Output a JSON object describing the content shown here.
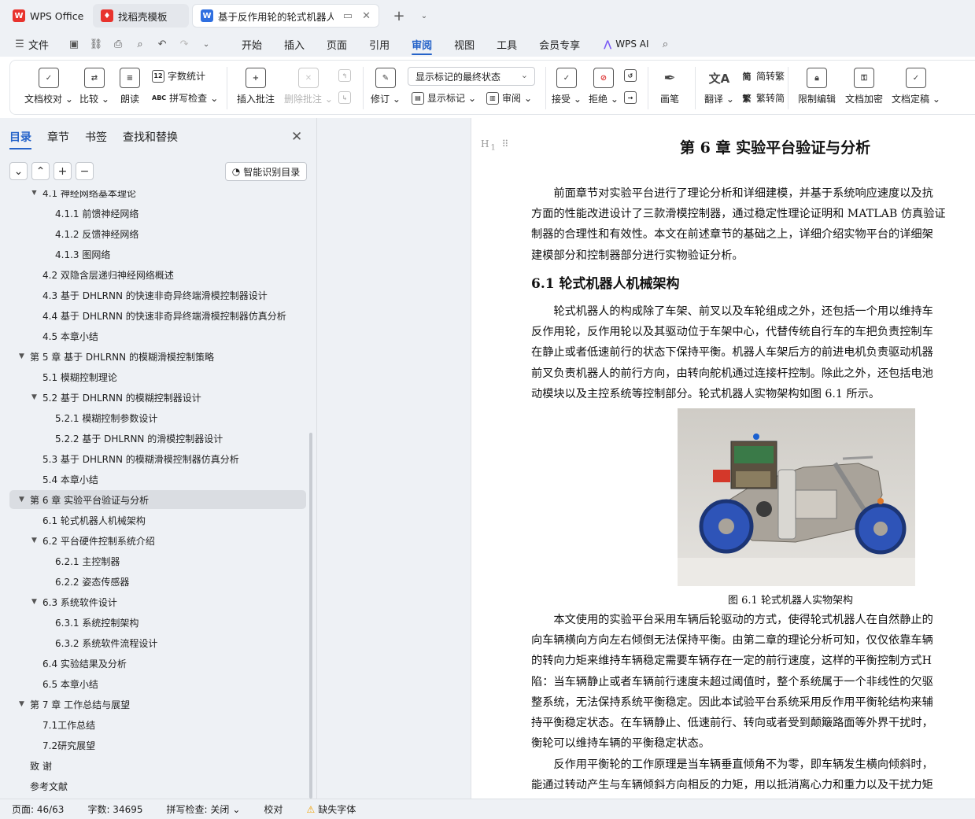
{
  "tabs": [
    {
      "label": "WPS Office",
      "icon": "wps-logo-icon",
      "color": "#e8332d"
    },
    {
      "label": "找稻壳模板",
      "icon": "docer-logo-icon",
      "color": "#e8332d"
    },
    {
      "label": "基于反作用轮的轮式机器人平衡",
      "icon": "writer-doc-icon",
      "color": "#2f6fe0"
    }
  ],
  "new_tab": "+",
  "menu": {
    "file": "文件",
    "items": [
      "开始",
      "插入",
      "页面",
      "引用",
      "审阅",
      "视图",
      "工具",
      "会员专享"
    ],
    "active": "审阅",
    "wps_ai": "WPS AI"
  },
  "ribbon": {
    "doc_check": "文档校对",
    "compare": "比较",
    "read_aloud": "朗读",
    "word_count": "字数统计",
    "spell_check": "拼写检查",
    "insert_comment": "插入批注",
    "delete_comment": "删除批注",
    "revise": "修订",
    "markup_select": "显示标记的最终状态",
    "show_markup": "显示标记",
    "review": "审阅",
    "accept": "接受",
    "reject": "拒绝",
    "pen": "画笔",
    "translate": "翻译",
    "to_traditional": "简转繁",
    "to_simplified": "繁转简",
    "restrict_edit": "限制编辑",
    "encrypt": "文档加密",
    "finalize": "文档定稿",
    "word_count_icon_text": "12",
    "spell_icon_text": "ABC"
  },
  "sidebar": {
    "tabs": [
      "目录",
      "章节",
      "书签",
      "查找和替换"
    ],
    "active_tab": "目录",
    "smart_toc": "智能识别目录",
    "toc": [
      {
        "label": "4.1 神经网络基本理论",
        "level": 2,
        "expanded": true
      },
      {
        "label": "4.1.1  前馈神经网络",
        "level": 3
      },
      {
        "label": "4.1.2  反馈神经网络",
        "level": 3
      },
      {
        "label": "4.1.3  图网络",
        "level": 3
      },
      {
        "label": "4.2  双隐含层递归神经网络概述",
        "level": 2
      },
      {
        "label": "4.3  基于 DHLRNN 的快速非奇异终端滑模控制器设计",
        "level": 2
      },
      {
        "label": "4.4  基于 DHLRNN 的快速非奇异终端滑模控制器仿真分析",
        "level": 2
      },
      {
        "label": "4.5  本章小结",
        "level": 2
      },
      {
        "label": "第 5 章  基于 DHLRNN 的模糊滑模控制策略",
        "level": 1,
        "expanded": true
      },
      {
        "label": "5.1  模糊控制理论",
        "level": 2
      },
      {
        "label": "5.2  基于 DHLRNN 的模糊控制器设计",
        "level": 2,
        "expanded": true
      },
      {
        "label": "5.2.1  模糊控制参数设计",
        "level": 3
      },
      {
        "label": "5.2.2  基于 DHLRNN 的滑模控制器设计",
        "level": 3
      },
      {
        "label": "5.3  基于 DHLRNN 的模糊滑模控制器仿真分析",
        "level": 2
      },
      {
        "label": "5.4  本章小结",
        "level": 2
      },
      {
        "label": "第 6 章  实验平台验证与分析",
        "level": 1,
        "expanded": true,
        "selected": true
      },
      {
        "label": "6.1  轮式机器人机械架构",
        "level": 2
      },
      {
        "label": "6.2  平台硬件控制系统介绍",
        "level": 2,
        "expanded": true
      },
      {
        "label": "6.2.1  主控制器",
        "level": 3
      },
      {
        "label": "6.2.2  姿态传感器",
        "level": 3
      },
      {
        "label": "6.3  系统软件设计",
        "level": 2,
        "expanded": true
      },
      {
        "label": "6.3.1  系统控制架构",
        "level": 3
      },
      {
        "label": "6.3.2  系统软件流程设计",
        "level": 3
      },
      {
        "label": "6.4  实验结果及分析",
        "level": 2
      },
      {
        "label": "6.5  本章小结",
        "level": 2
      },
      {
        "label": "第 7 章  工作总结与展望",
        "level": 1,
        "expanded": true
      },
      {
        "label": "7.1工作总结",
        "level": 2
      },
      {
        "label": "7.2研究展望",
        "level": 2
      },
      {
        "label": "致    谢",
        "level": 1
      },
      {
        "label": "参考文献",
        "level": 1
      }
    ]
  },
  "document": {
    "heading_marker": "H",
    "chapter_title": "第 6 章  实验平台验证与分析",
    "intro": [
      "前面章节对实验平台进行了理论分析和详细建模，并基于系统响应速度以及抗",
      "方面的性能改进设计了三款滑模控制器，通过稳定性理论证明和 MATLAB 仿真验证",
      "制器的合理性和有效性。本文在前述章节的基础之上，详细介绍实物平台的详细架",
      "建模部分和控制器部分进行实物验证分析。"
    ],
    "section_title": "6.1  轮式机器人机械架构",
    "para1": [
      "轮式机器人的构成除了车架、前叉以及车轮组成之外，还包括一个用以维持车",
      "反作用轮，反作用轮以及其驱动位于车架中心，代替传统自行车的车把负责控制车",
      "在静止或者低速前行的状态下保持平衡。机器人车架后方的前进电机负责驱动机器",
      "前叉负责机器人的前行方向，由转向舵机通过连接杆控制。除此之外，还包括电池",
      "动模块以及主控系统等控制部分。轮式机器人实物架构如图 6.1 所示。"
    ],
    "figure_caption": "图 6.1  轮式机器人实物架构",
    "para2": [
      "本文使用的实验平台采用车辆后轮驱动的方式，使得轮式机器人在自然静止的",
      "向车辆横向方向左右倾倒无法保持平衡。由第二章的理论分析可知，仅仅依靠车辆",
      "的转向力矩来维持车辆稳定需要车辆存在一定的前行速度，这样的平衡控制方式H",
      "陷：当车辆静止或者车辆前行速度未超过阈值时，整个系统属于一个非线性的欠驱",
      "整系统，无法保持系统平衡稳定。因此本试验平台系统采用反作用平衡轮结构来辅",
      "持平衡稳定状态。在车辆静止、低速前行、转向或者受到颠簸路面等外界干扰时，",
      "衡轮可以维持车辆的平衡稳定状态。"
    ],
    "para3": [
      "反作用平衡轮的工作原理是当车辆垂直倾角不为零，即车辆发生横向倾斜时，",
      "能通过转动产生与车辆倾斜方向相反的力矩，用以抵消离心力和重力以及干扰力矩"
    ]
  },
  "status": {
    "page": "页面: 46/63",
    "words": "字数: 34695",
    "spell": "拼写检查: 关闭",
    "proof": "校对",
    "missing_font": "缺失字体"
  },
  "colors": {
    "accent": "#2563c9",
    "wps_red": "#e8332d",
    "warning": "#f0a000"
  }
}
